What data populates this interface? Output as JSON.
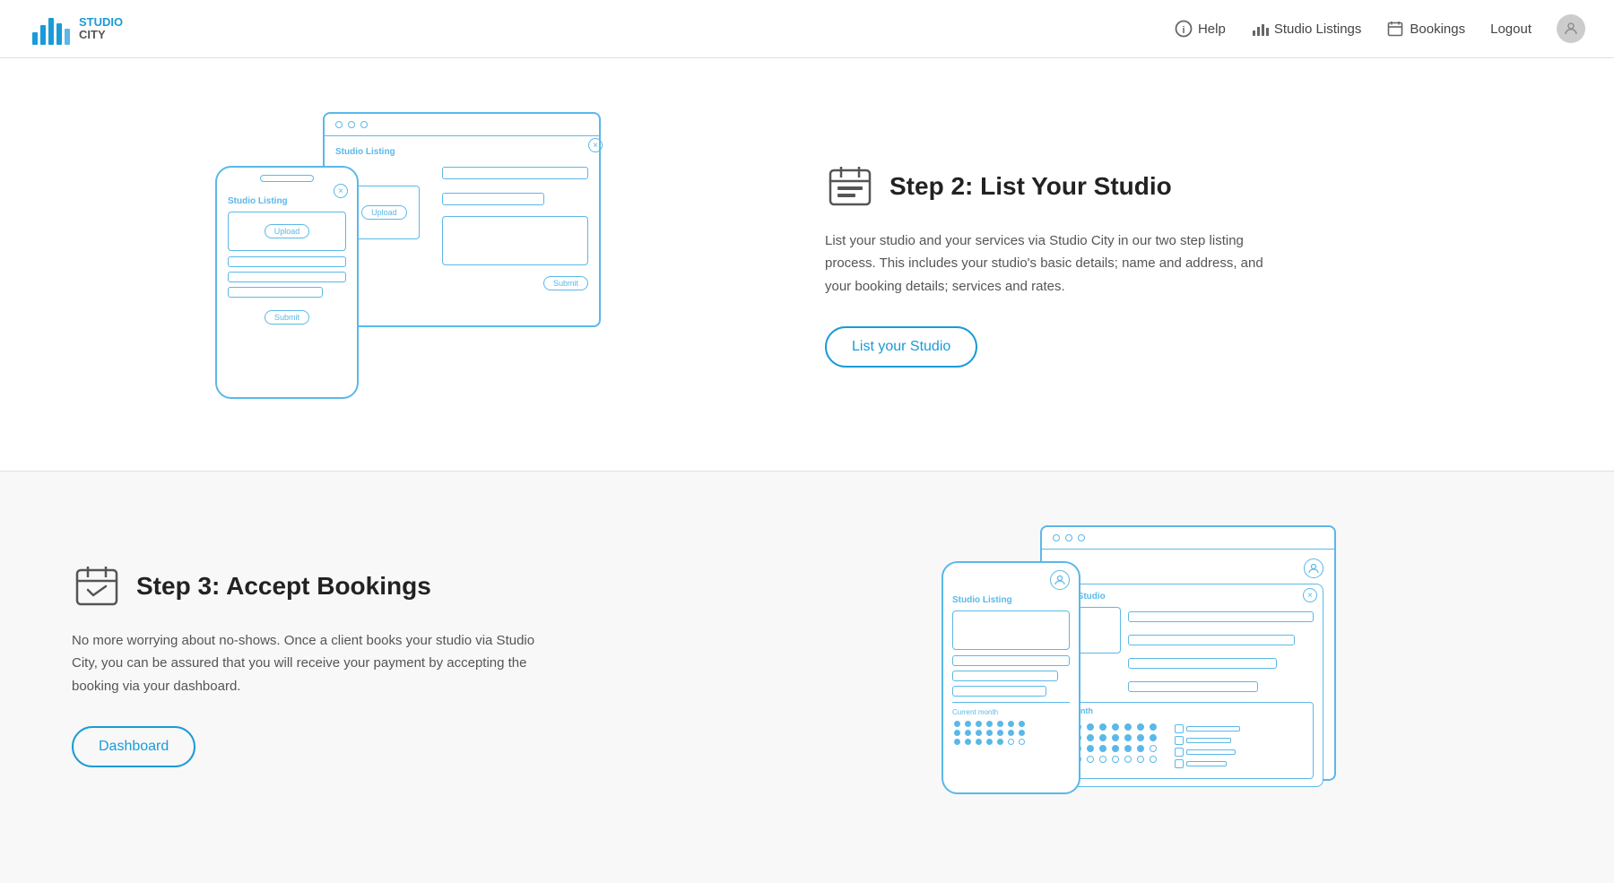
{
  "nav": {
    "logo_alt": "Studio City",
    "links": [
      {
        "label": "Help",
        "icon": "info-icon"
      },
      {
        "label": "Studio Listings",
        "icon": "chart-icon"
      },
      {
        "label": "Bookings",
        "icon": "calendar-icon"
      },
      {
        "label": "Logout",
        "icon": null
      }
    ]
  },
  "sections": [
    {
      "id": "step2",
      "step_number": "2",
      "title": "Step 2: List Your Studio",
      "description": "List your studio and your services via Studio City in our two step listing process. This includes your studio's basic details; name and address, and your booking details; services and rates.",
      "button_label": "List your Studio",
      "illustration": "studio-listing-wireframe"
    },
    {
      "id": "step3",
      "step_number": "3",
      "title": "Step 3: Accept Bookings",
      "description": "No more worrying about no-shows. Once a client books your studio via Studio City, you can be assured that you will receive your payment by accepting the booking via your dashboard.",
      "button_label": "Dashboard",
      "illustration": "bookings-wireframe"
    }
  ],
  "wireframe_labels": {
    "studio_listing": "Studio Listing",
    "upload": "Upload",
    "submit": "Submit",
    "my_studio": "My Studio",
    "current_month": "Current month",
    "month": "Month"
  }
}
